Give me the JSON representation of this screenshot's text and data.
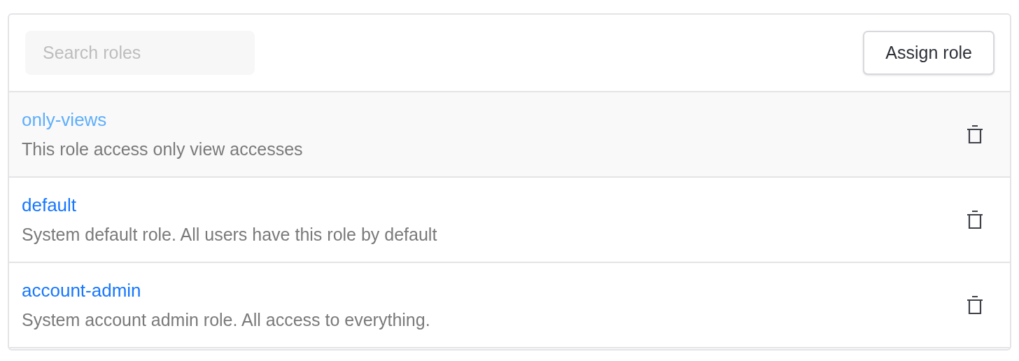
{
  "search": {
    "placeholder": "Search roles"
  },
  "assign_button": {
    "label": "Assign role"
  },
  "roles": [
    {
      "name": "only-views",
      "description": "This role access only view accesses",
      "highlighted": true
    },
    {
      "name": "default",
      "description": "System default role. All users have this role by default",
      "highlighted": false
    },
    {
      "name": "account-admin",
      "description": "System account admin role. All access to everything.",
      "highlighted": false
    }
  ]
}
